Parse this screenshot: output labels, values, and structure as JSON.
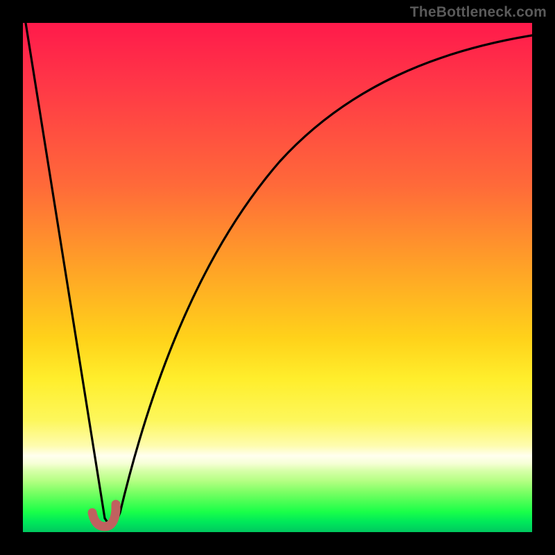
{
  "watermark": "TheBottleneck.com",
  "colors": {
    "frame": "#000000",
    "curve_stroke": "#000000",
    "marker_stroke": "#c0615f",
    "gradient_stops": [
      "#ff1a4b",
      "#ff3747",
      "#ff6a39",
      "#ffa227",
      "#ffd21a",
      "#ffee2c",
      "#fdf75b",
      "#fefcae",
      "#ffffef",
      "#f6ffd6",
      "#d6ffa8",
      "#b3ff82",
      "#7fff66",
      "#4cff55",
      "#1aff49",
      "#00e85a",
      "#00c95f"
    ]
  },
  "chart_data": {
    "type": "line",
    "title": "",
    "xlabel": "",
    "ylabel": "",
    "xlim": [
      0,
      100
    ],
    "ylim": [
      0,
      100
    ],
    "grid": false,
    "series": [
      {
        "name": "bottleneck-curve",
        "x": [
          0,
          5,
          10,
          13,
          15,
          16.3,
          18,
          20,
          22,
          25,
          28,
          32,
          36,
          40,
          45,
          50,
          55,
          60,
          65,
          70,
          75,
          80,
          85,
          90,
          95,
          100
        ],
        "y": [
          100,
          62,
          24,
          4,
          2,
          1,
          3,
          8,
          15,
          25,
          35,
          46,
          55,
          62,
          70,
          76,
          81,
          85,
          88,
          90.5,
          92.5,
          94,
          95.2,
          96.2,
          97,
          97.5
        ]
      },
      {
        "name": "optimum-marker",
        "x": [
          14.0,
          14.5,
          15.0,
          15.5,
          16.0,
          16.5,
          17.0,
          17.3,
          17.6,
          17.8,
          17.9
        ],
        "y": [
          4.2,
          2.4,
          1.6,
          1.2,
          1.2,
          1.4,
          1.8,
          2.4,
          3.2,
          4.0,
          4.8
        ]
      }
    ],
    "annotations": []
  }
}
